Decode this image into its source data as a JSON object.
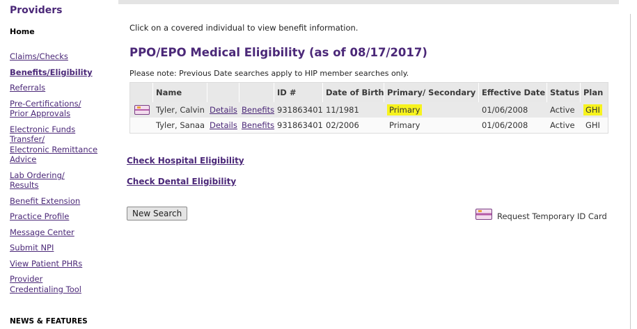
{
  "sidebar": {
    "heading": "Providers",
    "home": "Home",
    "items": [
      "Claims/Checks",
      "Benefits/Eligibility",
      "Referrals",
      "Pre-Certifications/",
      "Prior Approvals",
      "Electronic Funds",
      "Transfer/",
      "Electronic Remittance",
      "Advice",
      "Lab Ordering/",
      "Results",
      "Benefit Extension",
      "Practice Profile",
      "Message Center",
      "Submit NPI",
      "View Patient PHRs",
      "Provider",
      "Credentialing Tool"
    ],
    "news": "NEWS & FEATURES"
  },
  "main": {
    "intro": "Click on a covered individual to view benefit information.",
    "title": "PPO/EPO Medical Eligibility (as of 08/17/2017)",
    "note": "Please note: Previous Date searches apply to HIP member searches only.",
    "table": {
      "headers": [
        "Name",
        "ID #",
        "Date of Birth",
        "Primary/ Secondary",
        "Effective Date",
        "Status",
        "Plan"
      ],
      "rows": [
        {
          "name": "Tyler, Calvin",
          "details": "Details",
          "benefits": "Benefits",
          "id": "931863401",
          "dob": "11/1981",
          "primary": "Primary",
          "effective": "01/06/2008",
          "status": "Active",
          "plan": "GHI"
        },
        {
          "name": "Tyler, Sanaa",
          "details": "Details",
          "benefits": "Benefits",
          "id": "931863401",
          "dob": "02/2006",
          "primary": "Primary",
          "effective": "01/06/2008",
          "status": "Active",
          "plan": "GHI"
        }
      ]
    },
    "links": {
      "hospital": "Check Hospital Eligibility",
      "dental": "Check Dental Eligibility"
    },
    "new_search": "New Search",
    "request_card": "Request Temporary ID Card"
  },
  "colors": {
    "brand": "#4b2878",
    "highlight": "#f7f31e"
  },
  "icons": {
    "id_card": "id-card-icon"
  }
}
